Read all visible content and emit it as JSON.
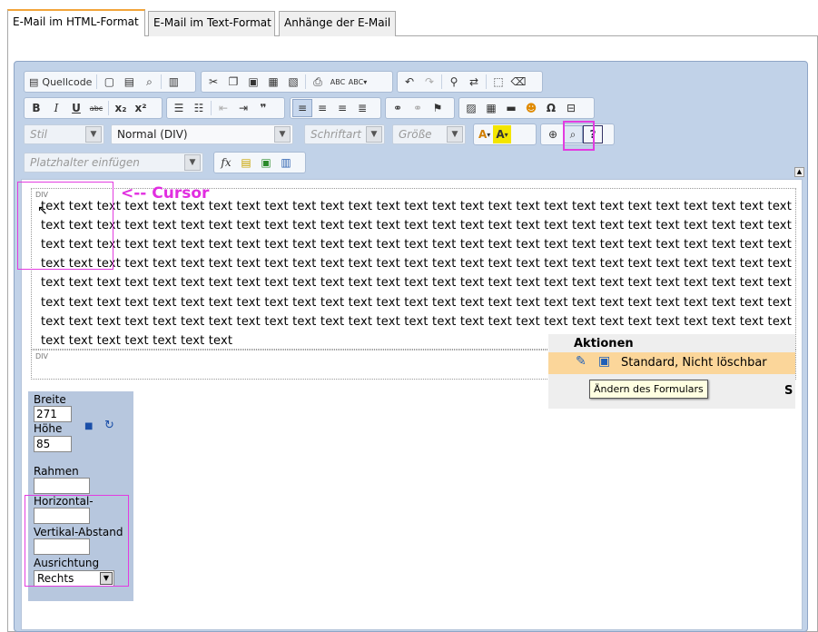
{
  "tabs": [
    "E-Mail im HTML-Format",
    "E-Mail im Text-Format",
    "Anhänge der E-Mail"
  ],
  "toolbar": {
    "source_label": "Quellcode",
    "style_placeholder": "Stil",
    "format_value": "Normal (DIV)",
    "font_placeholder": "Schriftart",
    "size_placeholder": "Größe",
    "placeholder_combo": "Platzhalter einfügen"
  },
  "editor": {
    "div_label_1": "DIV",
    "div_label_2": "DIV",
    "lines": [
      "text text text text text text text text text text text text text text text text text text text text text text text text text text text text",
      "text text text text text text text text text text text text text text text text text text text text text text text text text text text text",
      "text text text text text text text text text text text text text text text text text text text text text text text text text text text text",
      "text text text text text text text text text text text text text text text text text text text text text text text text text text text text",
      "text text text text text text text text text text text text text text text text text text text text text text text text text text text text",
      "text text text text text text text text text text text text text text text text text text text text text text text text text text text text",
      "text text text text text text text text text text text text text text text text text text text text text text text text text text text text",
      "text text text text text text text"
    ],
    "cursor_annotation": "<-- Cursor"
  },
  "aktionen": {
    "title": "Aktionen",
    "row_label": "Standard, Nicht löschbar",
    "tooltip": "Ändern des Formulars",
    "partial": "S"
  },
  "props": {
    "breite_label": "Breite",
    "breite_value": "271",
    "hoehe_label": "Höhe",
    "hoehe_value": "85",
    "rahmen_label": "Rahmen",
    "rahmen_value": "",
    "horizontal_label": "Horizontal-Abstand",
    "horizontal_value": "",
    "vertikal_label": "Vertikal-Abstand",
    "vertikal_value": "",
    "ausrichtung_label": "Ausrichtung",
    "ausrichtung_value": "Rechts"
  },
  "colors": {
    "accent_tab": "#f2a53a",
    "annotation": "#e12ee0",
    "editor_bg": "#c1d2e8",
    "action_row": "#fbd69a"
  }
}
